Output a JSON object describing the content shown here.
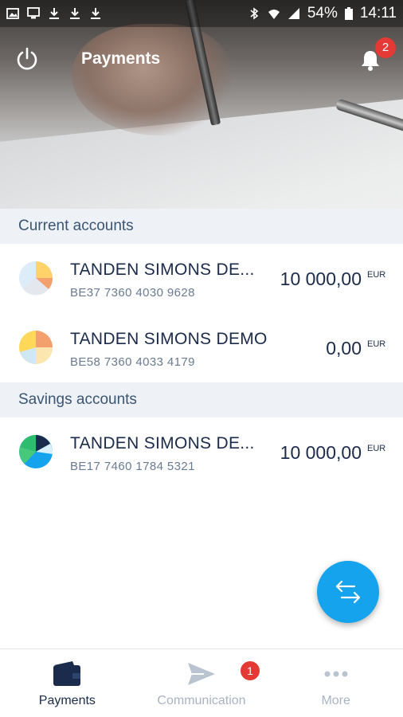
{
  "status_bar": {
    "battery": "54%",
    "time": "14:11"
  },
  "app_bar": {
    "title": "Payments",
    "notification_count": "2"
  },
  "sections": [
    {
      "title": "Current accounts",
      "accounts": [
        {
          "name": "TANDEN SIMONS DE...",
          "iban": "BE37 7360 4030 9628",
          "amount": "10 000,00",
          "currency": "EUR",
          "icon": "pie-chart-icon"
        },
        {
          "name": "TANDEN SIMONS DEMO",
          "iban": "BE58 7360 4033 4179",
          "amount": "0,00",
          "currency": "EUR",
          "icon": "pie-chart-icon"
        }
      ]
    },
    {
      "title": "Savings accounts",
      "accounts": [
        {
          "name": "TANDEN SIMONS DE...",
          "iban": "BE17 7460 1784 5321",
          "amount": "10 000,00",
          "currency": "EUR",
          "icon": "pie-chart-icon"
        }
      ]
    }
  ],
  "fab": {
    "icon": "transfer-arrows-icon"
  },
  "bottom_nav": {
    "items": [
      {
        "label": "Payments",
        "icon": "wallet-icon",
        "active": true
      },
      {
        "label": "Communication",
        "icon": "send-icon",
        "active": false,
        "badge": "1"
      },
      {
        "label": "More",
        "icon": "more-dots-icon",
        "active": false
      }
    ]
  },
  "colors": {
    "accent": "#14a3ec",
    "navy": "#1b2b4b",
    "badge": "#e53935",
    "section_bg": "#eef2f7"
  }
}
